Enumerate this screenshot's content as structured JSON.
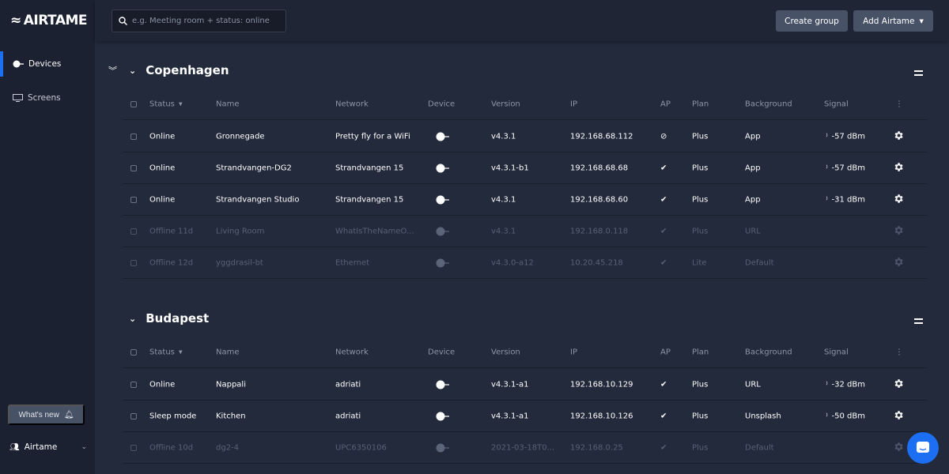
{
  "app": {
    "logo": "AIRTAME"
  },
  "sidebar": {
    "items": [
      {
        "label": "Devices",
        "icon": "device-icon",
        "active": true
      },
      {
        "label": "Screens",
        "icon": "monitor-icon"
      }
    ],
    "whats_new": "What's new",
    "account": "Airtame"
  },
  "header": {
    "search_placeholder": "e.g. Meeting room + status: online",
    "create_group": "Create group",
    "add_airtame": "Add Airtame"
  },
  "columns": [
    "Status",
    "Name",
    "Network",
    "Device",
    "Version",
    "IP",
    "AP",
    "Plan",
    "Background",
    "Signal"
  ],
  "colors": {
    "accent": "#1c6ef2",
    "sidebar": "#1b2130",
    "background": "#232a3b",
    "button": "#485267"
  },
  "groups": [
    {
      "name": "Copenhagen",
      "rows": [
        {
          "status": "Online",
          "name": "Gronnegade",
          "network": "Pretty fly for a WiFi",
          "version": "v4.3.1",
          "ip": "192.168.68.112",
          "ap": "disabled",
          "plan": "Plus",
          "background": "App",
          "signal": "-57 dBm",
          "online": true
        },
        {
          "status": "Online",
          "name": "Strandvangen-DG2",
          "network": "Strandvangen 15",
          "version": "v4.3.1-b1",
          "ip": "192.168.68.68",
          "ap": "check",
          "plan": "Plus",
          "background": "App",
          "signal": "-57 dBm",
          "online": true
        },
        {
          "status": "Online",
          "name": "Strandvangen Studio",
          "network": "Strandvangen 15",
          "version": "v4.3.1",
          "ip": "192.168.68.60",
          "ap": "check",
          "plan": "Plus",
          "background": "App",
          "signal": "-31 dBm",
          "online": true
        },
        {
          "status": "Offline 11d",
          "name": "Living Room",
          "network": "WhatIsTheNameO...",
          "version": "v4.3.1",
          "ip": "192.168.0.118",
          "ap": "check",
          "plan": "Plus",
          "background": "URL",
          "signal": "",
          "online": false
        },
        {
          "status": "Offline 12d",
          "name": "yggdrasil-bt",
          "network": "Ethernet",
          "version": "v4.3.0-a12",
          "ip": "10.20.45.218",
          "ap": "check",
          "plan": "Lite",
          "background": "Default",
          "signal": "",
          "online": false
        }
      ]
    },
    {
      "name": "Budapest",
      "rows": [
        {
          "status": "Online",
          "name": "Nappali",
          "network": "adriati",
          "version": "v4.3.1-a1",
          "ip": "192.168.10.129",
          "ap": "check",
          "plan": "Plus",
          "background": "URL",
          "signal": "-32 dBm",
          "online": true
        },
        {
          "status": "Sleep mode",
          "name": "Kitchen",
          "network": "adriati",
          "version": "v4.3.1-a1",
          "ip": "192.168.10.126",
          "ap": "check",
          "plan": "Plus",
          "background": "Unsplash",
          "signal": "-50 dBm",
          "online": true
        },
        {
          "status": "Offline 10d",
          "name": "dg2-4",
          "network": "UPC6350106",
          "version": "2021-03-18T0...",
          "ip": "192.168.0.25",
          "ap": "check",
          "plan": "Plus",
          "background": "Default",
          "signal": "",
          "online": false
        }
      ]
    }
  ]
}
